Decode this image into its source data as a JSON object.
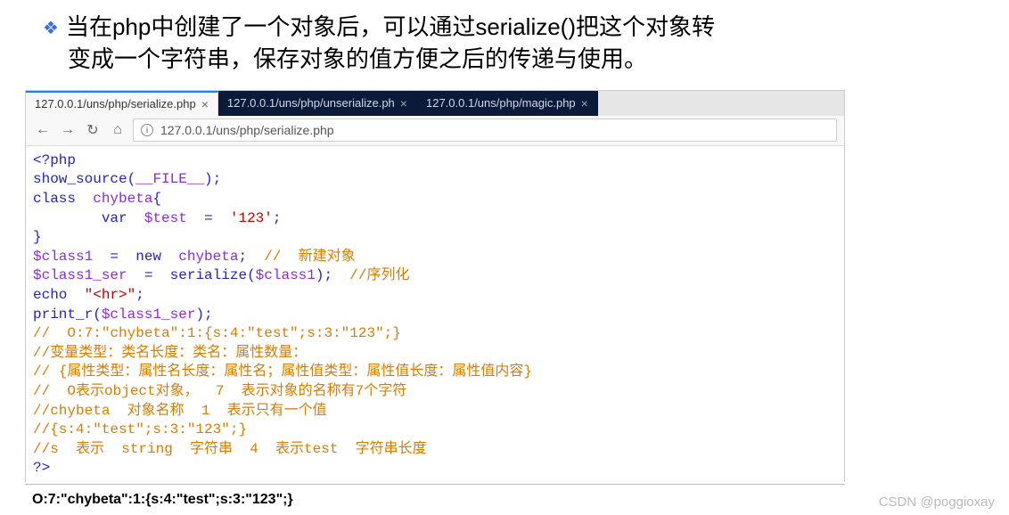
{
  "bullet": {
    "line1": "当在php中创建了一个对象后，可以通过serialize()把这个对象转",
    "line2": "变成一个字符串，保存对象的值方便之后的传递与使用。"
  },
  "tabs": [
    {
      "label": "127.0.0.1/uns/php/serialize.php",
      "active": true
    },
    {
      "label": "127.0.0.1/uns/php/unserialize.ph",
      "active": false
    },
    {
      "label": "127.0.0.1/uns/php/magic.php",
      "active": false
    }
  ],
  "url": {
    "value": "127.0.0.1/uns/php/serialize.php"
  },
  "code": {
    "l1": "<?php",
    "l2a": "show_source",
    "l2b": "(",
    "l2c": "__FILE__",
    "l2d": ");",
    "l3a": "class  ",
    "l3b": "chybeta",
    "l3c": "{",
    "l4a": "        var  ",
    "l4b": "$test  ",
    "l4c": "=  ",
    "l4d": "'123'",
    "l4e": ";",
    "l5": "}",
    "l6a": "$class1  ",
    "l6b": "=  new  ",
    "l6c": "chybeta",
    "l6d": ";  ",
    "l6e": "//  新建对象",
    "l7a": "$class1_ser  ",
    "l7b": "=  ",
    "l7c": "serialize",
    "l7d": "(",
    "l7e": "$class1",
    "l7f": ");  ",
    "l7g": "//序列化",
    "l8a": "echo  ",
    "l8b": "\"<hr>\"",
    "l8c": ";",
    "l9a": "print_r",
    "l9b": "(",
    "l9c": "$class1_ser",
    "l9d": ");",
    "l10": "//  O:7:\"chybeta\":1:{s:4:\"test\";s:3:\"123\";}",
    "l11": "//变量类型：类名长度：类名：属性数量：",
    "l12": "// {属性类型：属性名长度：属性名；属性值类型：属性值长度：属性值内容}",
    "l13": "//  O表示object对象，  7  表示对象的名称有7个字符",
    "l14": "//chybeta  对象名称  1  表示只有一个值",
    "l15": "//{s:4:\"test\";s:3:\"123\";}",
    "l16": "//s  表示  string  字符串  4  表示test  字符串长度",
    "l17": "?>"
  },
  "output": "O:7:\"chybeta\":1:{s:4:\"test\";s:3:\"123\";}",
  "watermark": "CSDN @poggioxay"
}
